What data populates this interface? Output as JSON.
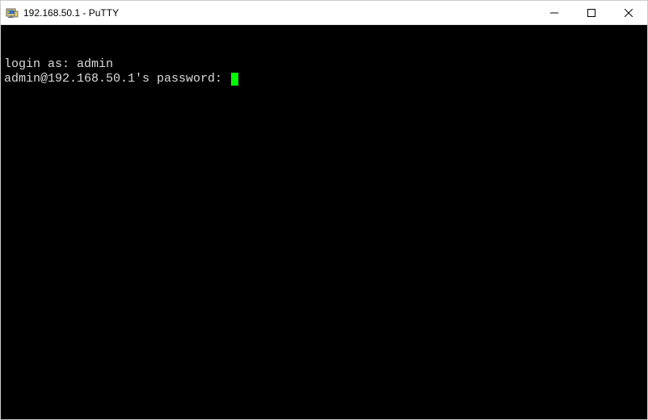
{
  "window": {
    "title": "192.168.50.1 - PuTTY"
  },
  "terminal": {
    "lines": [
      "login as: admin",
      "admin@192.168.50.1's password: "
    ]
  }
}
